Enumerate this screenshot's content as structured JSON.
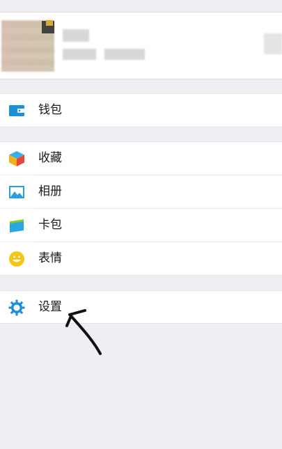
{
  "profile": {
    "avatar_icon": "avatar",
    "name_blurred": true
  },
  "menu": {
    "wallet": {
      "label": "钱包",
      "icon": "wallet-icon",
      "color": "#1b8fd8"
    },
    "favorites": {
      "label": "收藏",
      "icon": "cube-icon"
    },
    "album": {
      "label": "相册",
      "icon": "picture-icon",
      "color": "#2a9fdf"
    },
    "cards": {
      "label": "卡包",
      "icon": "card-icon"
    },
    "stickers": {
      "label": "表情",
      "icon": "smile-icon",
      "color": "#f5c518"
    },
    "settings": {
      "label": "设置",
      "icon": "gear-icon",
      "color": "#1b8fd8"
    }
  },
  "annotation": {
    "icon": "hand-drawn-arrow-icon"
  }
}
